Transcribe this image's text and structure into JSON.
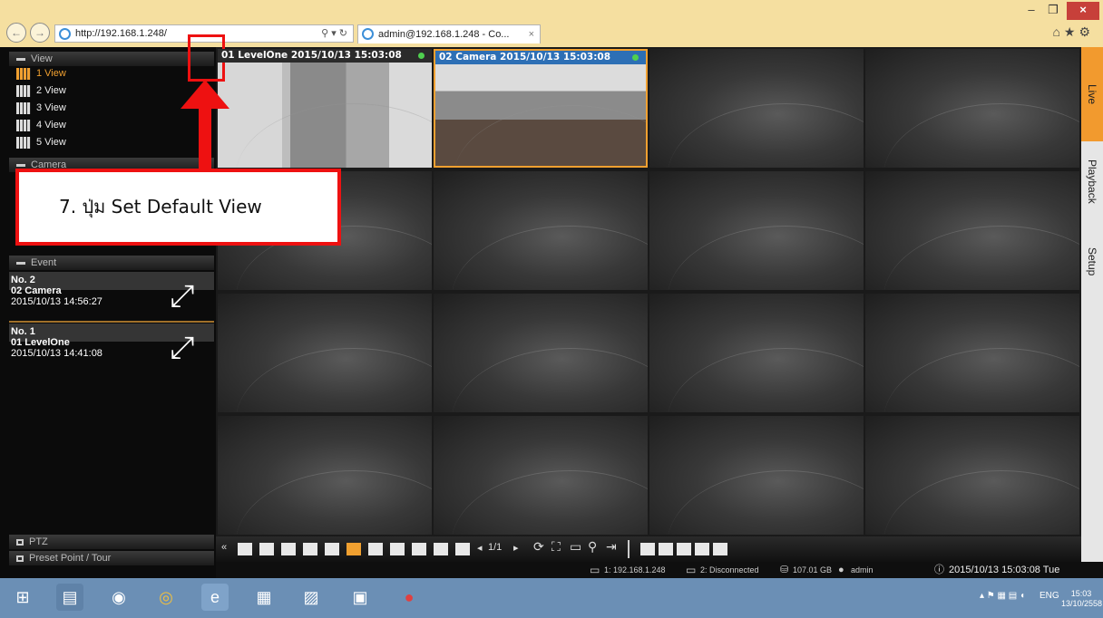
{
  "browser": {
    "url": "http://192.168.1.248/",
    "tab_title": "admin@192.168.1.248 - Co...",
    "tab_close": "×",
    "back": "←",
    "forward": "→",
    "search_refresh": "⚲ ▾ ↻",
    "right_icons": "⌂★⚙",
    "minimize": "–",
    "restore": "❐",
    "close": "×"
  },
  "left_panel": {
    "view_header": "View",
    "views": [
      "1 View",
      "2 View",
      "3 View",
      "4 View",
      "5 View"
    ],
    "active_view": "1 View",
    "camera_header": "Camera",
    "event_header": "Event",
    "events": [
      {
        "no": "No. 2",
        "camera": "02 Camera",
        "time": "2015/10/13 14:56:27"
      },
      {
        "no": "No. 1",
        "camera": "01 LevelOne",
        "time": "2015/10/13 14:41:08"
      }
    ],
    "ptz": "PTZ",
    "preset": "Preset Point / Tour"
  },
  "cameras": [
    {
      "title": "01 LevelOne  2015/10/13 15:03:08"
    },
    {
      "title": "02 Camera  2015/10/13 15:03:08"
    }
  ],
  "side_tabs": {
    "live": "Live",
    "playback": "Playback",
    "setup": "Setup"
  },
  "toolbar": {
    "prev": "«",
    "page": "1/1",
    "page_prev": "◂",
    "page_next": "▸"
  },
  "status": {
    "server": "1: 192.168.1.248",
    "disconnected": "2: Disconnected",
    "disk": "107.01 GB",
    "user": "admin",
    "datetime": "2015/10/13 15:03:08 Tue"
  },
  "annotation": {
    "text": "7. ปุ่ม Set Default View"
  },
  "taskbar": {
    "lang": "ENG",
    "time": "15:03",
    "date": "13/10/2558"
  },
  "colors": {
    "accent": "#f0a030",
    "annotation": "#ee1111",
    "cam2_title": "#2d6fb5"
  }
}
